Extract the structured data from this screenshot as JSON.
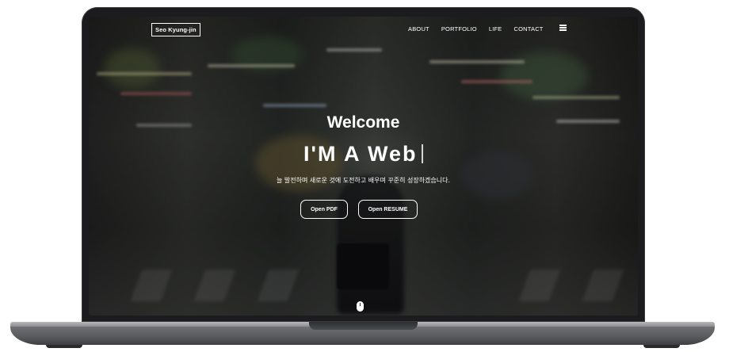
{
  "site": {
    "brand": "Seo Kyung-jin",
    "nav": [
      "ABOUT",
      "PORTFOLIO",
      "LIFE",
      "CONTACT"
    ],
    "menu_icon": "hamburger-menu-icon"
  },
  "hero": {
    "welcome": "Welcome",
    "headline": "I'M A Web",
    "tagline": "늘 발전하며 새로운 것에 도전하고 배우며 꾸준히 성장하겠습니다.",
    "buttons": {
      "pdf": "Open PDF",
      "resume": "Open RESUME"
    },
    "scroll_icon": "mouse-scroll-icon"
  },
  "colors": {
    "text": "#ffffff",
    "bezel": "#1c1c1e",
    "base": "#5a5b5e"
  }
}
